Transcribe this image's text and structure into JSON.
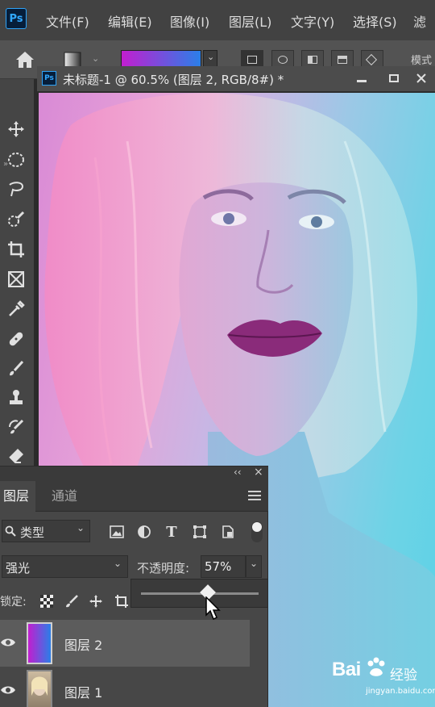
{
  "app": {
    "logo": "Ps"
  },
  "menu": [
    "文件(F)",
    "编辑(E)",
    "图像(I)",
    "图层(L)",
    "文字(Y)",
    "选择(S)",
    "滤"
  ],
  "options_bar": {
    "mode_label": "模式",
    "gradient_colors": [
      "#c21ecf",
      "#2a7fe8"
    ],
    "mode_icons": [
      "linear-gradient-icon",
      "radial-gradient-icon",
      "angle-gradient-icon",
      "reflected-gradient-icon",
      "diamond-gradient-icon"
    ]
  },
  "toolbar": {
    "tools": [
      "move-icon",
      "marquee-icon",
      "lasso-icon",
      "quick-select-icon",
      "crop-icon",
      "frame-icon",
      "eyedropper-icon",
      "healing-icon",
      "brush-icon",
      "stamp-icon",
      "history-brush-icon",
      "eraser-icon"
    ]
  },
  "document": {
    "icon": "Ps",
    "title": "未标题-1 @ 60.5% (图层 2, RGB/8#) *",
    "canvas_colors": [
      "#e38ad0",
      "#5cd2e6"
    ]
  },
  "layers_panel": {
    "controls": {
      "collapse": "‹‹",
      "close": "×"
    },
    "tabs": [
      "图层",
      "通道"
    ],
    "filter": {
      "label": "类型",
      "icons": [
        "image-filter-icon",
        "adjustment-filter-icon",
        "type-filter-icon",
        "shape-filter-icon",
        "smart-object-filter-icon"
      ]
    },
    "blend_mode": "强光",
    "opacity_label": "不透明度:",
    "opacity_value": "57%",
    "opacity_fraction": 0.57,
    "lock_label": "锁定:",
    "layers": [
      {
        "name": "图层 2",
        "selected": true,
        "visible": true
      },
      {
        "name": "图层 1",
        "selected": false,
        "visible": true
      }
    ]
  },
  "watermark": {
    "main": "Bai",
    "suffix": "经验",
    "sub": "jingyan.baidu.com"
  }
}
